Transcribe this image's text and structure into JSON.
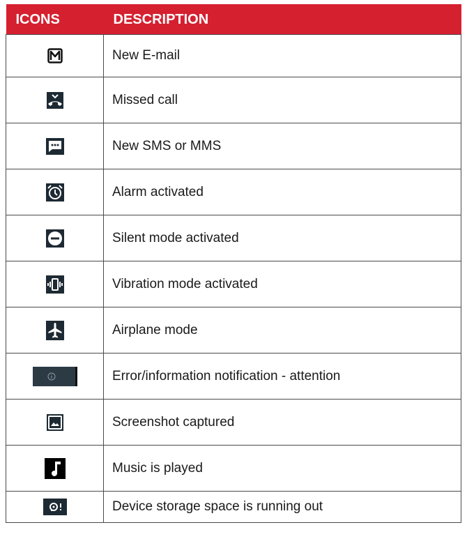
{
  "header": {
    "icons": "ICONS",
    "description": "DESCRIPTION"
  },
  "rows": [
    {
      "icon": "email-icon",
      "description": "New E-mail"
    },
    {
      "icon": "missed-call-icon",
      "description": "Missed call"
    },
    {
      "icon": "sms-icon",
      "description": "New SMS or MMS"
    },
    {
      "icon": "alarm-icon",
      "description": "Alarm activated"
    },
    {
      "icon": "silent-mode-icon",
      "description": "Silent mode activated"
    },
    {
      "icon": "vibration-icon",
      "description": "Vibration mode activated"
    },
    {
      "icon": "airplane-icon",
      "description": "Airplane mode"
    },
    {
      "icon": "info-icon",
      "description": "Error/information notification - attention"
    },
    {
      "icon": "screenshot-icon",
      "description": "Screenshot captured"
    },
    {
      "icon": "music-icon",
      "description": "Music is played"
    },
    {
      "icon": "storage-warning-icon",
      "description": "Device storage space is running out"
    }
  ],
  "colors": {
    "header_bg": "#d52030",
    "icon_bg": "#1e2a33"
  }
}
